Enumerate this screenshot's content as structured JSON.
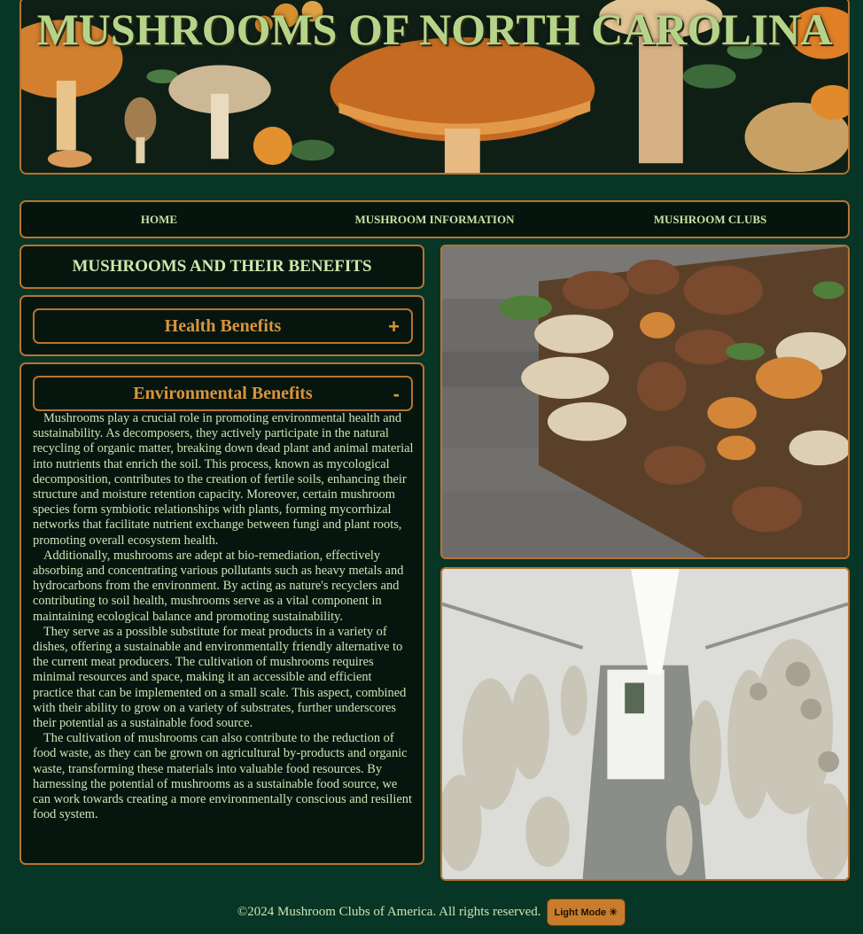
{
  "banner": {
    "title": "MUSHROOMS OF NORTH CAROLINA",
    "image": "forest-mushrooms-illustration"
  },
  "nav": {
    "items": [
      {
        "label": "HOME"
      },
      {
        "label": "MUSHROOM INFORMATION"
      },
      {
        "label": "MUSHROOM CLUBS"
      }
    ]
  },
  "main": {
    "heading": "MUSHROOMS AND THEIR BENEFITS",
    "accordions": [
      {
        "title": "Health Benefits",
        "toggle": "+",
        "expanded": false
      },
      {
        "title": "Environmental Benefits",
        "toggle": "-",
        "expanded": true,
        "paragraphs": [
          "Mushrooms play a crucial role in promoting environmental health and sustainability. As decomposers, they actively participate in the natural recycling of organic matter, breaking down dead plant and animal material into nutrients that enrich the soil. This process, known as mycological decomposition, contributes to the creation of fertile soils, enhancing their structure and moisture retention capacity. Moreover, certain mushroom species form symbiotic relationships with plants, forming mycorrhizal networks that facilitate nutrient exchange between fungi and plant roots, promoting overall ecosystem health.",
          "Additionally, mushrooms are adept at bio-remediation, effectively absorbing and concentrating various pollutants such as heavy metals and hydrocarbons from the environment. By acting as nature's recyclers and contributing to soil health, mushrooms serve as a vital component in maintaining ecological balance and promoting sustainability.",
          "They serve as a possible substitute for meat products in a variety of dishes, offering a sustainable and environmentally friendly alternative to the current meat producers. The cultivation of mushrooms requires minimal resources and space, making it an accessible and efficient practice that can be implemented on a small scale. This aspect, combined with their ability to grow on a variety of substrates, further underscores their potential as a sustainable food source.",
          "The cultivation of mushrooms can also contribute to the reduction of food waste, as they can be grown on agricultural by-products and organic waste, transforming these materials into valuable food resources. By harnessing the potential of mushrooms as a sustainable food source, we can work towards creating a more environmentally conscious and resilient food system."
        ]
      }
    ]
  },
  "photos": [
    {
      "subject": "basket-of-assorted-mushrooms-photo"
    },
    {
      "subject": "mushroom-grow-room-photo"
    }
  ],
  "footer": {
    "copyright": "©2024 Mushroom Clubs of America. All rights reserved.",
    "mode_button": "Light Mode ☀"
  },
  "colors": {
    "background": "#073526",
    "border": "#b8732f",
    "panel": "#06160f",
    "accent_text": "#d9943c",
    "body_text": "#cfe3b4",
    "button": "#c97d2c"
  }
}
